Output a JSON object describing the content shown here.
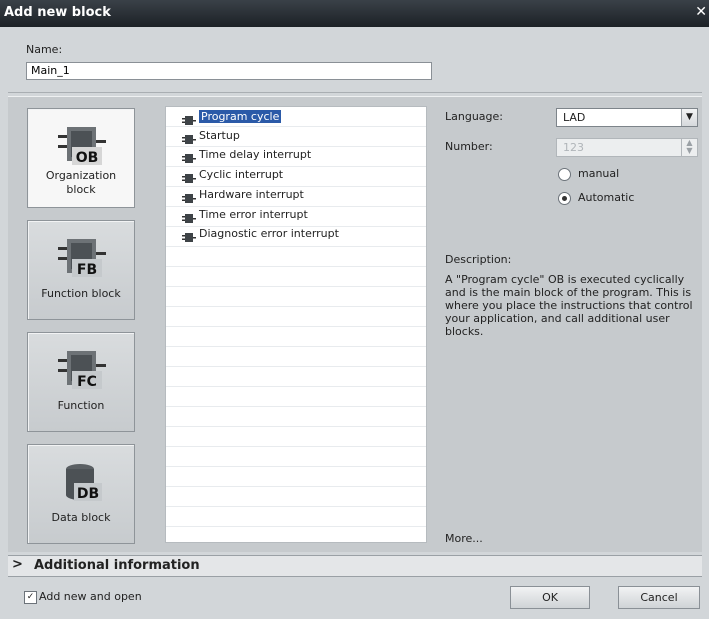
{
  "dialog": {
    "title": "Add new block"
  },
  "name": {
    "label": "Name:",
    "value": "Main_1"
  },
  "block_types": [
    {
      "badge": "OB",
      "label_line1": "Organization",
      "label_line2": "block",
      "selected": true
    },
    {
      "badge": "FB",
      "label_line1": "Function block",
      "label_line2": "",
      "selected": false
    },
    {
      "badge": "FC",
      "label_line1": "Function",
      "label_line2": "",
      "selected": false
    },
    {
      "badge": "DB",
      "label_line1": "Data block",
      "label_line2": "",
      "selected": false
    }
  ],
  "ob_list": [
    {
      "label": "Program cycle",
      "selected": true
    },
    {
      "label": "Startup"
    },
    {
      "label": "Time delay interrupt"
    },
    {
      "label": "Cyclic interrupt"
    },
    {
      "label": "Hardware interrupt"
    },
    {
      "label": "Time error interrupt"
    },
    {
      "label": "Diagnostic error interrupt"
    }
  ],
  "properties": {
    "language_label": "Language:",
    "language_value": "LAD",
    "number_label": "Number:",
    "number_value": "123",
    "radio_manual": "manual",
    "radio_automatic": "Automatic",
    "selected_radio": "Automatic",
    "description_label": "Description:",
    "description_text": "A \"Program cycle\" OB is executed cyclically and is the main block of the program. This is where you place the instructions that control your application, and call additional user blocks.",
    "more_link": "More..."
  },
  "additional_info": {
    "label": "Additional information"
  },
  "footer": {
    "checkbox_label": "Add new and open",
    "checkbox_checked": true,
    "ok_label": "OK",
    "cancel_label": "Cancel"
  },
  "colors": {
    "selection": "#2b5aa8",
    "titlebar": "#1c2126",
    "badge_green": "#4fb33a"
  }
}
